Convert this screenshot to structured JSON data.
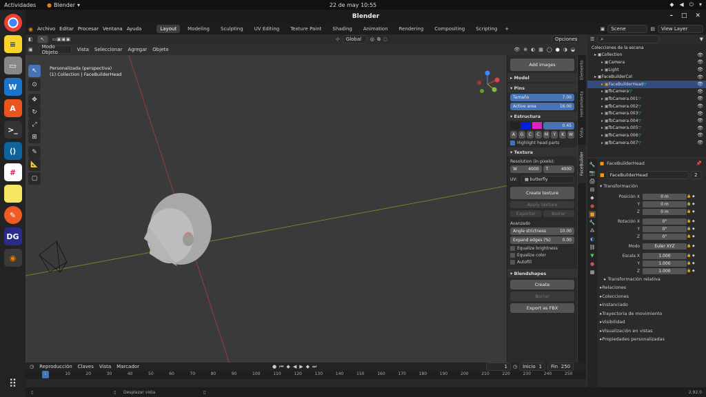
{
  "topbar": {
    "activities": "Actividades",
    "app": "Blender",
    "clock": "22 de may  10:55"
  },
  "window": {
    "title": "Blender"
  },
  "menu": {
    "items": [
      "Archivo",
      "Editar",
      "Procesar",
      "Ventana",
      "Ayuda"
    ]
  },
  "workspaces": [
    "Layout",
    "Modeling",
    "Sculpting",
    "UV Editing",
    "Texture Paint",
    "Shading",
    "Animation",
    "Rendering",
    "Compositing",
    "Scripting"
  ],
  "top_right": {
    "scene": "Scene",
    "view_layer": "View Layer"
  },
  "viewport": {
    "mode": "Modo Objeto",
    "menus": [
      "Vista",
      "Seleccionar",
      "Agregar",
      "Objeto"
    ],
    "transform_orientation": "Global",
    "options": "Opciones",
    "info_line1": "Personalizada (perspectiva)",
    "info_line2": "(1) Collection | FaceBuilderHead"
  },
  "npanel": {
    "add_images": "Add images",
    "model": "Model",
    "pins": "Pins",
    "size_label": "Tamaño",
    "size_value": "7.00",
    "active_area_label": "Active area",
    "active_area_value": "16.00",
    "structure": "Estructura",
    "opacity": "0.45",
    "letters": [
      "A",
      "G",
      "C",
      "C",
      "M",
      "Y",
      "K",
      "W"
    ],
    "highlight": "Highlight head parts",
    "texture": "Textura",
    "resolution": "Resolution (in pixels):",
    "res_w_label": "W",
    "res_w": "4000",
    "res_h_label": "T",
    "res_h": "4000",
    "uv_label": "UV:",
    "uv_value": "butterfly",
    "create_texture": "Create texture",
    "apply_texture": "Apply texture",
    "export": "Exportar",
    "delete": "Borrar",
    "advanced": "Avanzado",
    "angle_label": "Angle strictness",
    "angle_value": "10.00",
    "expand_label": "Expand edges (%)",
    "expand_value": "0.00",
    "equalize_brightness": "Equalize brightness",
    "equalize_color": "Equalize color",
    "autofill": "Autofill",
    "blendshapes": "Blendshapes",
    "create": "Create",
    "delete2": "Borrar",
    "export_fbx": "Export as FBX"
  },
  "ntabs": [
    "Elemento",
    "Herramienta",
    "Vista",
    "FaceBuilder"
  ],
  "outliner": {
    "title": "Colecciones de la escena",
    "rows": [
      "Collection",
      "Camera",
      "Light",
      "FaceBuilderCol",
      "FaceBuilderHead",
      "fbCamera",
      "fbCamera.001",
      "fbCamera.002",
      "fbCamera.003",
      "fbCamera.004",
      "fbCamera.005",
      "fbCamera.006",
      "fbCamera.007"
    ]
  },
  "properties": {
    "object_name": "FaceBuilderHead",
    "data_name": "FaceBuilderHead",
    "users": "2",
    "transform": "Transformación",
    "location": [
      {
        "label": "Posición X",
        "value": "0 m"
      },
      {
        "label": "Y",
        "value": "0 m"
      },
      {
        "label": "Z",
        "value": "0 m"
      }
    ],
    "rotation": [
      {
        "label": "Rotación X",
        "value": "0°"
      },
      {
        "label": "Y",
        "value": "0°"
      },
      {
        "label": "Z",
        "value": "0°"
      }
    ],
    "mode_label": "Modo",
    "mode_value": "Euler XYZ",
    "scale": [
      {
        "label": "Escala X",
        "value": "1.000"
      },
      {
        "label": "Y",
        "value": "1.000"
      },
      {
        "label": "Z",
        "value": "1.000"
      }
    ],
    "delta": "Transformación relativa",
    "sections": [
      "Relaciones",
      "Colecciones",
      "Instanciado",
      "Trayectoria de movimiento",
      "Visibilidad",
      "Visualización en vistas",
      "Propiedades personalizadas"
    ]
  },
  "timeline": {
    "menus": [
      "Reproducción",
      "Claves",
      "Vista",
      "Marcador"
    ],
    "current": "1",
    "start_label": "Inicio",
    "start": "1",
    "end_label": "Fin",
    "end": "250",
    "ticks": [
      "1",
      "10",
      "20",
      "30",
      "40",
      "50",
      "60",
      "70",
      "80",
      "90",
      "100",
      "110",
      "120",
      "130",
      "140",
      "150",
      "160",
      "170",
      "180",
      "190",
      "200",
      "210",
      "220",
      "230",
      "240",
      "250"
    ]
  },
  "status": {
    "hint": "Desplazar vista",
    "version": "2.92.0"
  }
}
